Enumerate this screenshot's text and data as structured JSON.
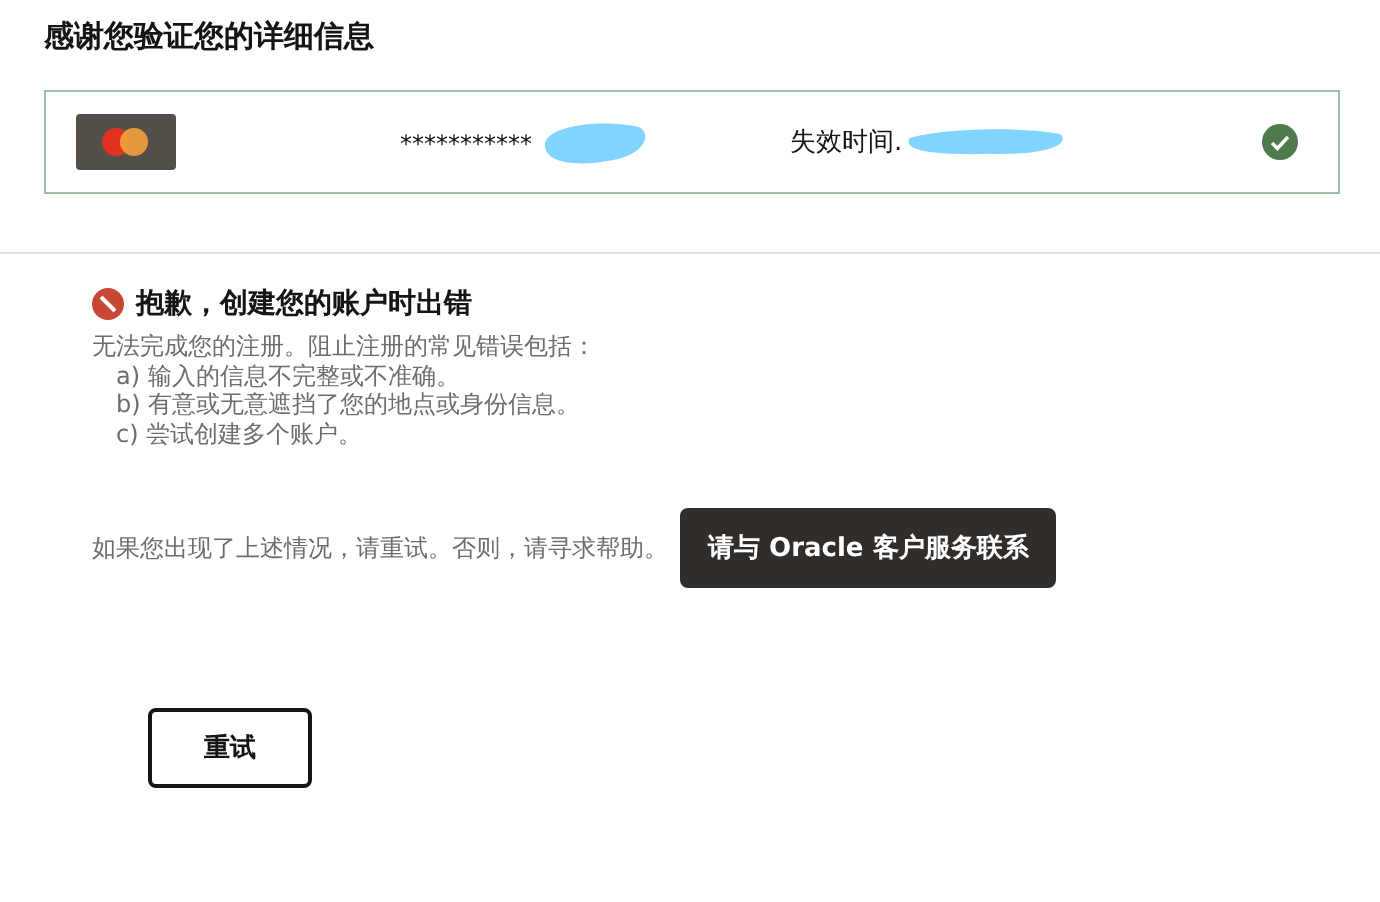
{
  "title": "感谢您验证您的详细信息",
  "card": {
    "number": "***********",
    "expiry_label": "失效时间.",
    "verified": true
  },
  "error": {
    "heading": "抱歉，创建您的账户时出错",
    "intro": "无法完成您的注册。阻止注册的常见错误包括：",
    "reasons": [
      "a) 输入的信息不完整或不准确。",
      "b) 有意或无意遮挡了您的地点或身份信息。",
      "c) 尝试创建多个账户。"
    ],
    "help_text": "如果您出现了上述情况，请重试。否则，请寻求帮助。",
    "contact_button": "请与 Oracle 客户服务联系"
  },
  "retry_button": "重试"
}
